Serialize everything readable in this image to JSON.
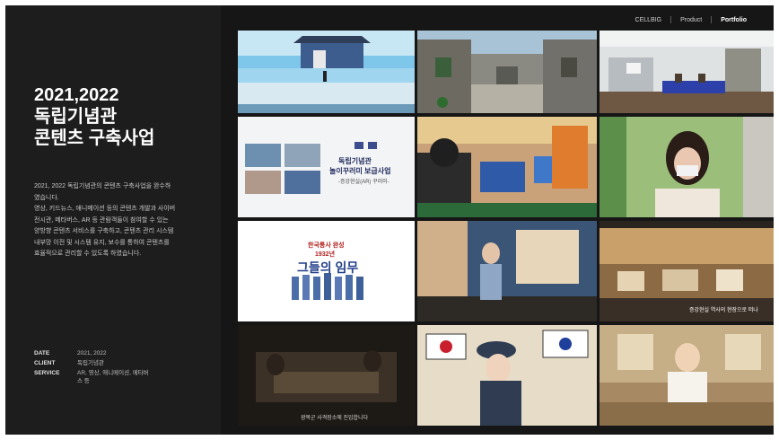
{
  "nav": {
    "items": [
      {
        "label": "CELLBIG",
        "active": false
      },
      {
        "label": "Product",
        "active": false
      },
      {
        "label": "Portfolio",
        "active": true
      }
    ]
  },
  "project": {
    "title_lines": [
      "2021,2022",
      "독립기념관",
      "콘텐츠 구축사업"
    ],
    "description_lines": [
      "2021, 2022 독립기념관의 콘텐츠 구축사업을 완수하",
      "였습니다.",
      "영상, 키드뉴스, 애니메이션 등의 콘텐츠 개발과 사이버",
      "전시관, 메타버스, AR 등 관람객들이 참여할 수 있는",
      "양방향 콘텐츠 서비스를 구축하고, 콘텐츠 관리 시스템",
      "내부망 이전 및 시스템 유지, 보수를 통하여 콘텐츠를",
      "효율적으로 관리할 수 있도록 하였습니다."
    ],
    "meta": [
      {
        "key": "DATE",
        "value": "2021, 2022"
      },
      {
        "key": "CLIENT",
        "value": "독립기념관"
      },
      {
        "key": "SERVICE",
        "value": "AR, 영상, 애니메이션, 메타버스 등"
      }
    ]
  },
  "tiles": {
    "t4_title_1": "독립기념관",
    "t4_title_2": "놀이꾸러미 보급사업",
    "t4_subtitle": "-증강현실(AR) 꾸러미-",
    "t7_line_1": "한국통사 완성",
    "t7_line_2": "1932년",
    "t7_big": "그들의 임무",
    "t9_caption": "증강현실 역사의 현장으로 떠나",
    "t10_caption": "광복군 사격장소에 진입합니다"
  },
  "colors": {
    "background": "#1a1a1a",
    "accent_blue": "#2a6fd6",
    "title_text": "#ffffff"
  }
}
